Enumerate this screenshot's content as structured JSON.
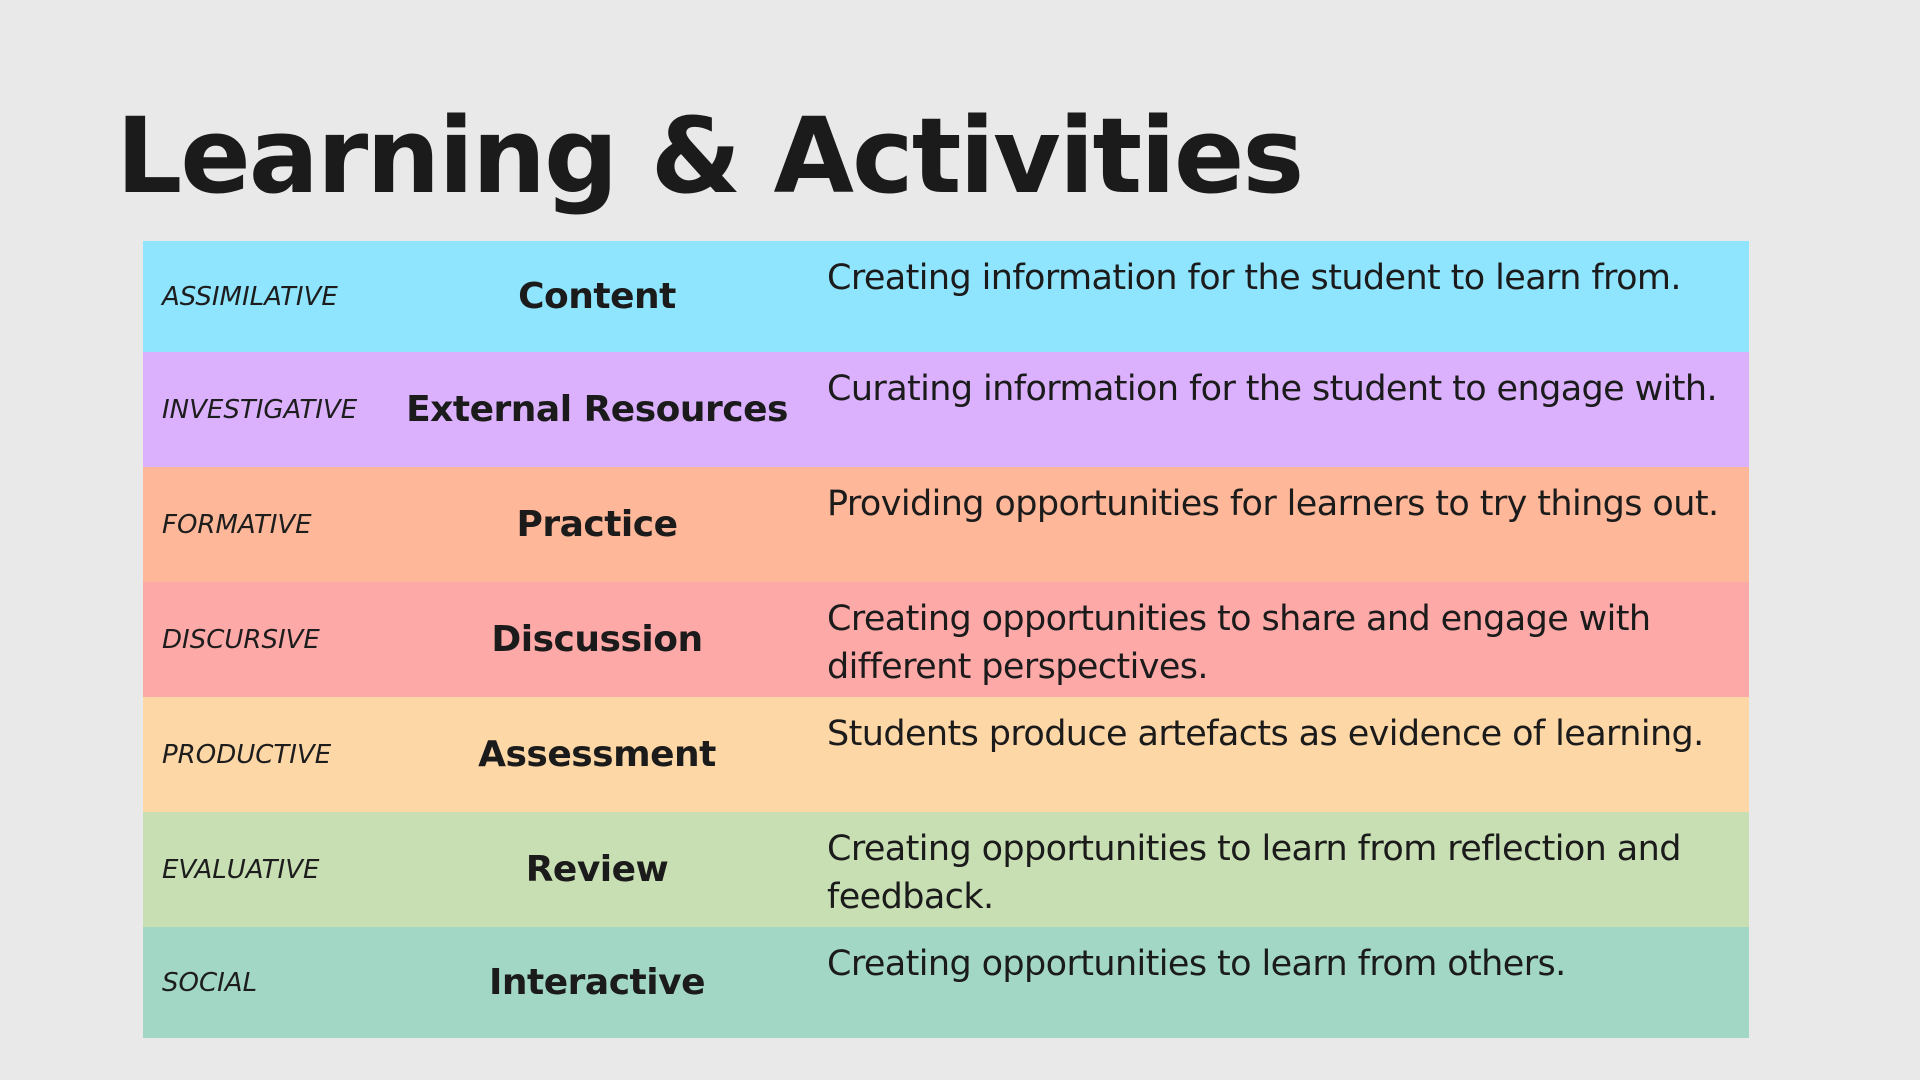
{
  "title": "Learning & Activities",
  "rows": [
    {
      "type": "ASSIMILATIVE",
      "name": "Content",
      "description": "Creating information for the student to learn from.",
      "color": "#8fe4fe"
    },
    {
      "type": "INVESTIGATIVE",
      "name": "External Resources",
      "description": "Curating information for the student to engage with.",
      "color": "#dbb0fd"
    },
    {
      "type": "FORMATIVE",
      "name": "Practice",
      "description": "Providing opportunities for learners to try things out.",
      "color": "#feb798"
    },
    {
      "type": "DISCURSIVE",
      "name": "Discussion",
      "description": "Creating opportunities to share and engage with different perspectives.",
      "color": "#fda9a8"
    },
    {
      "type": "PRODUCTIVE",
      "name": "Assessment",
      "description": "Students produce artefacts as evidence of learning.",
      "color": "#fed7a6"
    },
    {
      "type": "EVALUATIVE",
      "name": "Review",
      "description": "Creating opportunities to learn from reflection and feedback.",
      "color": "#c8dfb4"
    },
    {
      "type": "SOCIAL",
      "name": "Interactive",
      "description": "Creating opportunities to learn from others.",
      "color": "#a2d7c6"
    }
  ]
}
